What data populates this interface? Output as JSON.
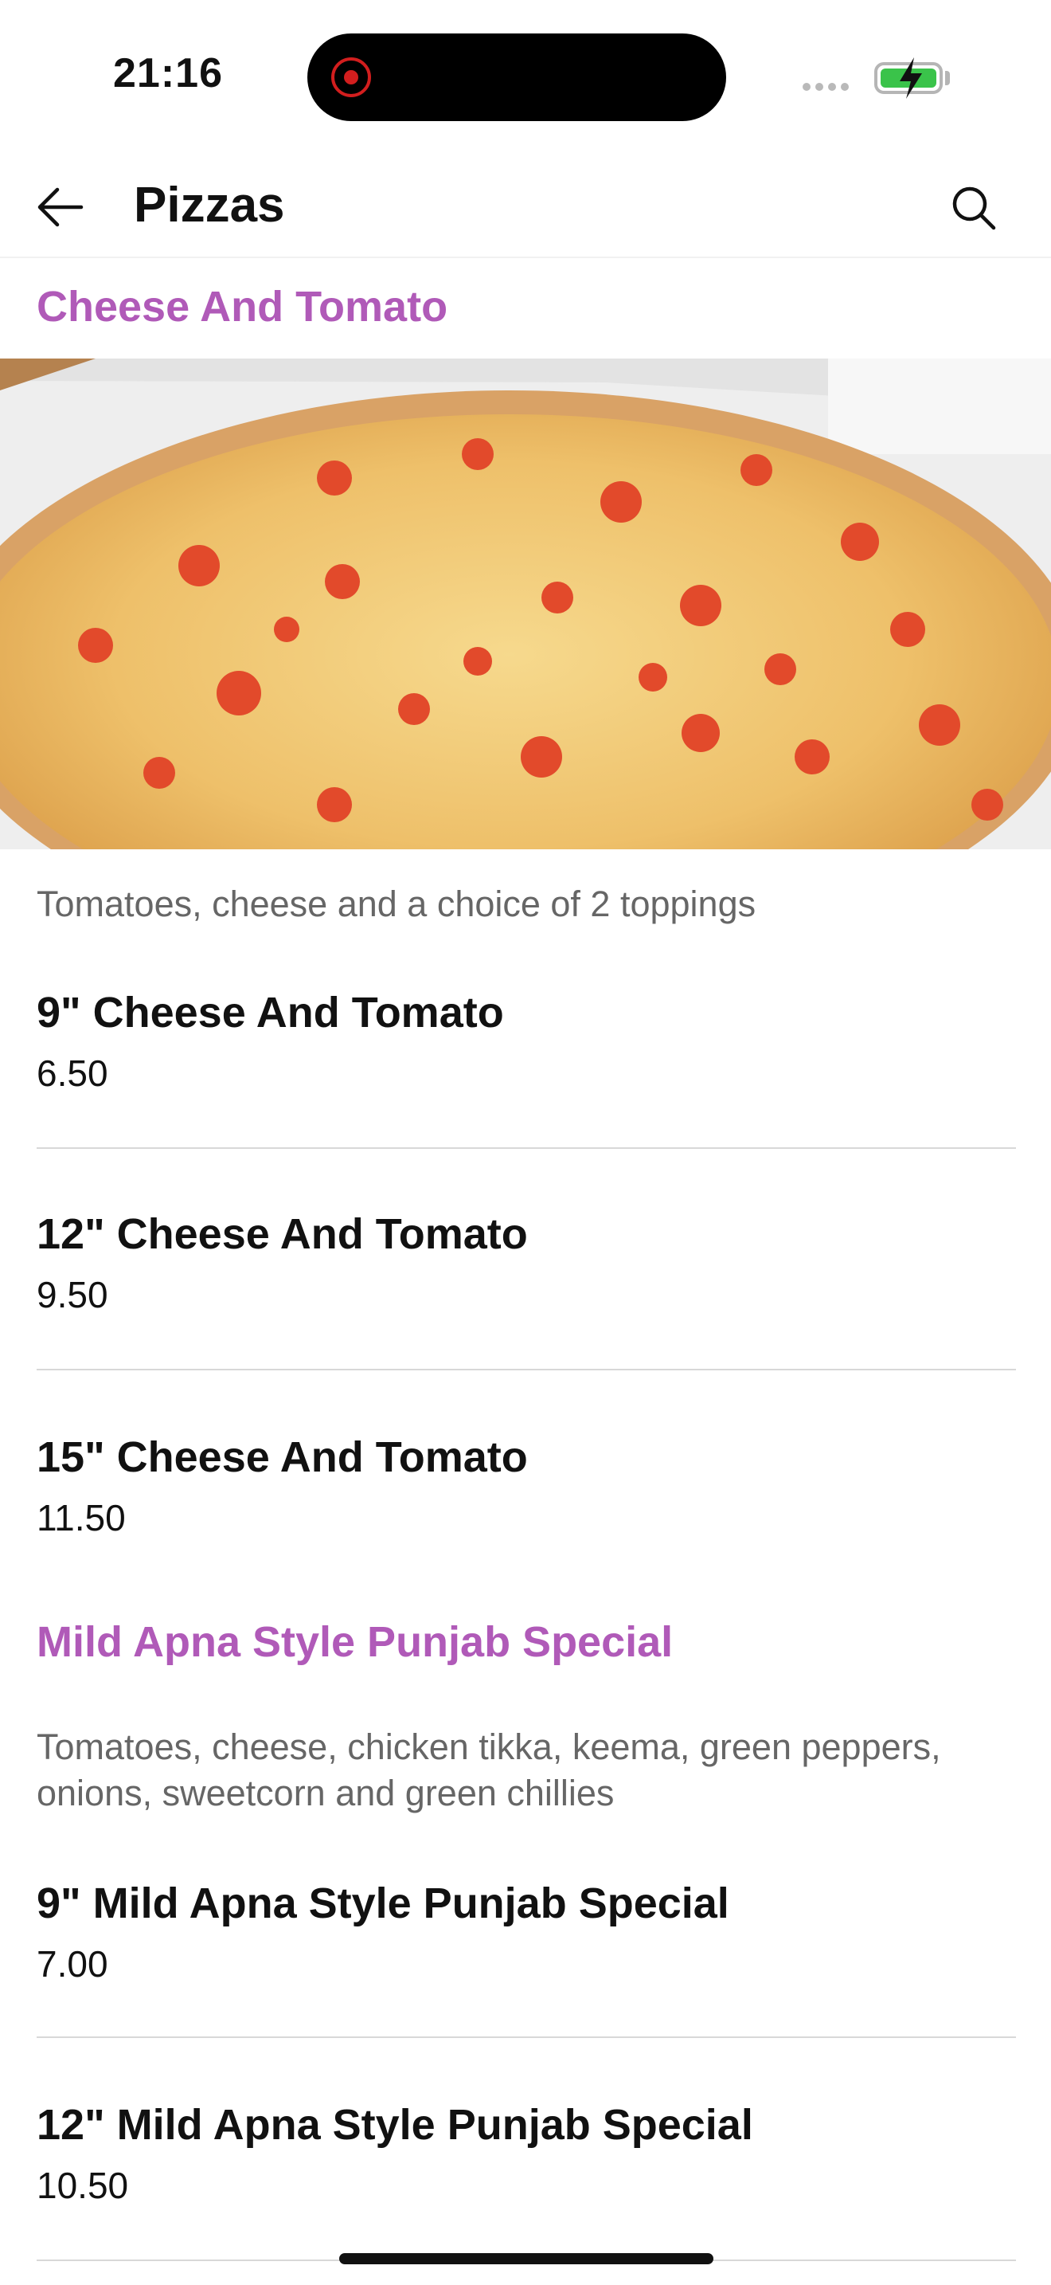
{
  "status": {
    "time": "21:16"
  },
  "header": {
    "title": "Pizzas"
  },
  "icons": {
    "back": "arrow-left-icon",
    "search": "search-icon",
    "record": "record-icon",
    "battery": "battery-charging-icon"
  },
  "colors": {
    "accent": "#b05ab8",
    "battery": "#3ac34a"
  },
  "sections": [
    {
      "title": "Cheese And Tomato",
      "description": "Tomatoes, cheese and a choice of 2 toppings",
      "items": [
        {
          "name": "9\" Cheese And Tomato",
          "price": "6.50"
        },
        {
          "name": "12\" Cheese And Tomato",
          "price": "9.50"
        },
        {
          "name": "15\" Cheese And Tomato",
          "price": "11.50"
        }
      ]
    },
    {
      "title": "Mild Apna Style Punjab Special",
      "description": "Tomatoes, cheese, chicken tikka, keema, green peppers, onions, sweetcorn and green chillies",
      "items": [
        {
          "name": "9\" Mild Apna Style Punjab Special",
          "price": "7.00"
        },
        {
          "name": "12\" Mild Apna Style Punjab Special",
          "price": "10.50"
        }
      ]
    }
  ]
}
